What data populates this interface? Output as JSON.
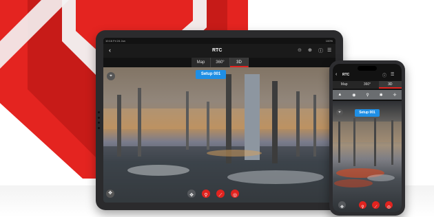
{
  "colors": {
    "brand_red": "#e0231f",
    "accent_blue": "#1f8fe5",
    "bezel": "#2b2b2d"
  },
  "tablet": {
    "status_time": "10:16 Fri 24 Jun",
    "status_battery": "100%",
    "title": "RTC",
    "back_icon": "chevron-left-icon",
    "tabs": [
      {
        "label": "Map",
        "active": false
      },
      {
        "label": "360°",
        "active": false
      },
      {
        "label": "3D",
        "active": true
      }
    ],
    "setup_label": "Setup 001",
    "bottom_tools": [
      "move-icon",
      "pin-icon",
      "measure-icon",
      "camera-icon"
    ]
  },
  "phone": {
    "title": "RTC",
    "tabs": [
      {
        "label": "Map",
        "active": false
      },
      {
        "label": "360°",
        "active": false
      },
      {
        "label": "3D",
        "active": true
      }
    ],
    "setup_label": "Setup 001",
    "toolbar_icons": [
      "warning-icon",
      "target-icon",
      "pin-icon",
      "gear-icon",
      "crosshair-icon"
    ],
    "bottom_tools": [
      "move-icon",
      "pin-icon",
      "measure-icon",
      "camera-icon"
    ]
  }
}
